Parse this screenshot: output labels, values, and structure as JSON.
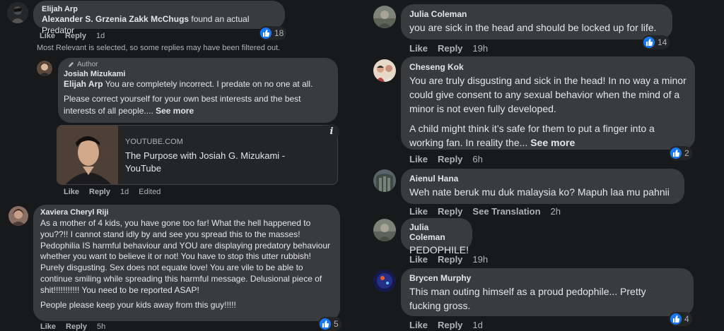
{
  "left": {
    "c1": {
      "name": "Elijah Arp",
      "tag": "Alexander S. Grzenia Zakk McChugs",
      "text": " found an actual Predator",
      "like": "Like",
      "reply": "Reply",
      "time": "1d",
      "count": "18"
    },
    "filter_note": "Most Relevant is selected, so some replies may have been filtered out.",
    "c2": {
      "badge": "Author",
      "name": "Josiah Mizukami",
      "tag": "Elijah Arp",
      "text1": " You are completely incorrect. I predate on no one at all.",
      "text2": "Please correct yourself for your own best interests and the best interests of all people....",
      "see_more": "See more",
      "link_domain": "YOUTUBE.COM",
      "link_title": "The Purpose with Josiah G. Mizukami - YouTube",
      "like": "Like",
      "reply": "Reply",
      "time": "1d",
      "edited": "Edited"
    },
    "c3": {
      "name": "Xaviera Cheryl Riji",
      "text1": "As a mother of 4 kids, you have gone too far! What the hell happened to you??!! I cannot stand idly by and see you spread this to the masses! Pedophilia IS harmful behaviour and YOU are displaying predatory behaviour whether you want to believe it or not! You have to stop this utter rubbish! Purely disgusting. Sex does not equate love! You are vile to be able to continue smiling while spreading this harmful message. Delusional piece of shit!!!!!!!!!!! You need to be reported ASAP!",
      "text2": "People please keep your kids away from this guy!!!!!",
      "like": "Like",
      "reply": "Reply",
      "time": "5h",
      "count": "5"
    }
  },
  "right": {
    "c1": {
      "name": "Julia Coleman",
      "text": "you are sick in the head and should be locked up for life.",
      "like": "Like",
      "reply": "Reply",
      "time": "19h",
      "count": "14"
    },
    "c2": {
      "name": "Cheseng Kok",
      "text1": "You are truly disgusting and sick in the head! In no way a minor could give consent to any sexual behavior when the mind of a minor is not even fully developed.",
      "text2": "A child might think it’s safe for them to put a finger into a working fan. In reality the...",
      "see_more": "See more",
      "like": "Like",
      "reply": "Reply",
      "time": "6h",
      "count": "2"
    },
    "c3": {
      "name": "Aienul Hana",
      "text": "Weh nate beruk mu duk malaysia ko? Mapuh laa mu pahnii",
      "like": "Like",
      "reply": "Reply",
      "translate": "See Translation",
      "time": "2h"
    },
    "c4": {
      "name": "Julia Coleman",
      "text": "PEDOPHILE!",
      "like": "Like",
      "reply": "Reply",
      "time": "19h"
    },
    "c5": {
      "name": "Brycen Murphy",
      "text": "This man outing himself as a proud pedophile... Pretty fucking gross.",
      "like": "Like",
      "reply": "Reply",
      "time": "1d",
      "count": "4"
    }
  },
  "icons": [
    "avatar",
    "pencil-icon",
    "info-icon",
    "like-reaction-icon",
    "video-thumbnail"
  ],
  "colors": {
    "background": "#18191a",
    "bubble": "#3a3b3c",
    "text": "#e4e6eb",
    "muted": "#b0b3b8",
    "like_blue": "#1877f2"
  }
}
